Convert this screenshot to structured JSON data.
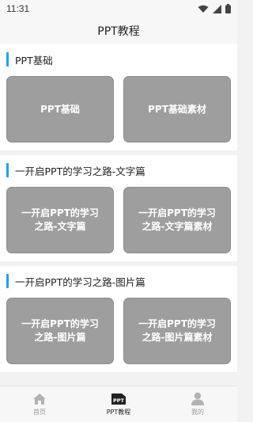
{
  "status": {
    "time": "11:31"
  },
  "header": {
    "title": "PPT教程"
  },
  "sections": [
    {
      "title": "PPT基础",
      "cards": [
        "PPT基础",
        "PPT基础素材"
      ]
    },
    {
      "title": "一开启PPT的学习之路-文字篇",
      "cards": [
        "一开启PPT的学习之路-文字篇",
        "一开启PPT的学习之路-文字篇素材"
      ]
    },
    {
      "title": "一开启PPT的学习之路-图片篇",
      "cards": [
        "一开启PPT的学习之路-图片篇",
        "一开启PPT的学习之路-图片篇素材"
      ]
    }
  ],
  "tabbar": {
    "items": [
      {
        "label": "首页",
        "icon": "home-icon"
      },
      {
        "label": "PPT教程",
        "icon": "ppt-icon",
        "icon_text": "PPT"
      },
      {
        "label": "我的",
        "icon": "user-icon"
      }
    ],
    "active": 1
  },
  "colors": {
    "accent": "#1aa7f2",
    "card": "#9e9e9e"
  }
}
